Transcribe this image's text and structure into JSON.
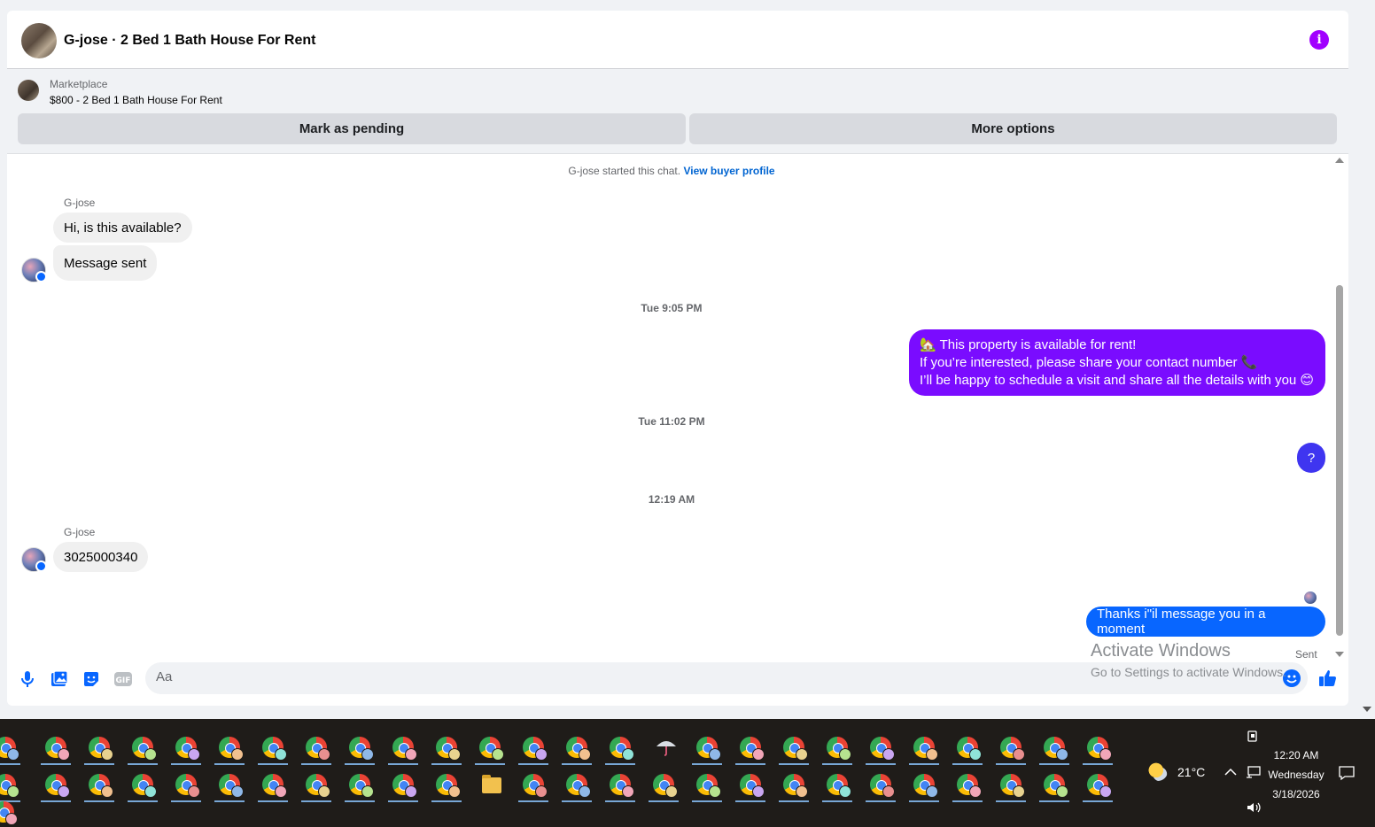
{
  "header": {
    "title": "G-jose · 2 Bed 1 Bath House For Rent",
    "info_icon": "i"
  },
  "listing": {
    "label": "Marketplace",
    "price_title": "$800 - 2 Bed 1 Bath House For Rent",
    "btn_pending": "Mark as pending",
    "btn_more": "More options"
  },
  "chat": {
    "started_text": "G-jose started this chat.",
    "view_profile": "View buyer profile",
    "sender_name_1": "G-jose",
    "msg_in_1": "Hi, is this available?",
    "msg_in_2": "Message sent",
    "time_1": "Tue 9:05 PM",
    "msg_out_1_line1": "🏡 This property is available for rent!",
    "msg_out_1_line2": "If you’re interested, please share your contact number 📞",
    "msg_out_1_line3": "I’ll be happy to schedule a visit and share all the details with you 😊",
    "time_2": "Tue 11:02 PM",
    "msg_out_2": "?",
    "time_3": "12:19 AM",
    "sender_name_2": "G-jose",
    "msg_in_3": "3025000340",
    "msg_out_3": "Thanks i\"il message you in a moment",
    "sent_status": "Sent"
  },
  "composer": {
    "placeholder": "Aa"
  },
  "watermark": {
    "line1": "Activate Windows",
    "line2": "Go to Settings to activate Windows."
  },
  "taskbar": {
    "weather_temp": "21°C",
    "clock_time": "12:20 AM",
    "clock_day": "Wednesday",
    "clock_date": "3/18/2026"
  },
  "colors": {
    "accent_purple": "#7a0cff",
    "accent_blue": "#0866ff",
    "info_purple": "#a100ff"
  }
}
